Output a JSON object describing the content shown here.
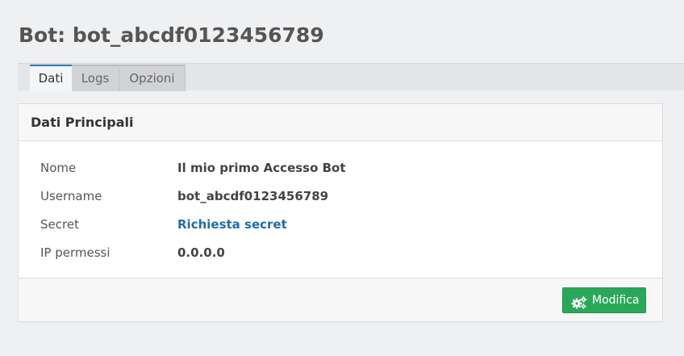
{
  "page": {
    "title": "Bot: bot_abcdf0123456789"
  },
  "tabs": [
    {
      "label": "Dati",
      "active": true
    },
    {
      "label": "Logs",
      "active": false
    },
    {
      "label": "Opzioni",
      "active": false
    }
  ],
  "panel": {
    "title": "Dati Principali",
    "fields": [
      {
        "label": "Nome",
        "value": "Il mio primo Accesso Bot"
      },
      {
        "label": "Username",
        "value": "bot_abcdf0123456789"
      },
      {
        "label": "Secret",
        "value": "Richiesta secret"
      },
      {
        "label": "IP permessi",
        "value": "0.0.0.0"
      }
    ],
    "edit_button": {
      "label": "Modifica",
      "icon": "gears-icon"
    }
  },
  "colors": {
    "accent": "#2a78b5",
    "link": "#1f6ea8",
    "button": "#2aa85a",
    "background": "#eff0f2"
  }
}
